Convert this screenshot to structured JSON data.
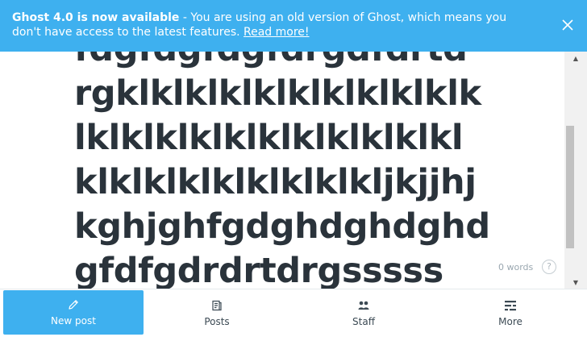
{
  "banner": {
    "bold": "Ghost 4.0 is now available",
    "message": " - You are using an old version of Ghost, which means you don't have access to the latest features. ",
    "link": "Read more!",
    "close_icon": "close-icon"
  },
  "editor": {
    "title_lines": [
      "fdgfdgfdgfdrgdfdrtd",
      "rgklklklklklklklklklklk",
      "lklklklklklklklklklklkl",
      "klklklklklklklklkljkjjhj",
      "kghjghfgdghdghdghd",
      "gfdfgdrdrtdrgsssss"
    ],
    "word_count": "0 words",
    "help_label": "?"
  },
  "tabs": [
    {
      "label": "New post",
      "icon": "pencil-icon",
      "active": true
    },
    {
      "label": "Posts",
      "icon": "posts-icon",
      "active": false
    },
    {
      "label": "Staff",
      "icon": "staff-icon",
      "active": false
    },
    {
      "label": "More",
      "icon": "more-icon",
      "active": false
    }
  ],
  "colors": {
    "accent": "#3eb0ef",
    "title_text": "#2a333b"
  }
}
